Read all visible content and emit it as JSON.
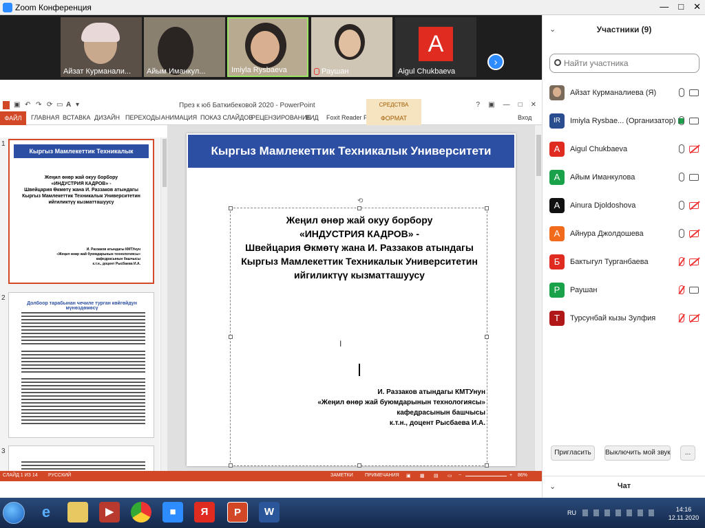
{
  "window": {
    "title": "Zoom Конференция",
    "buttons": [
      "—",
      "□",
      "✕"
    ]
  },
  "videos": [
    {
      "name": "Айзат Курманали...",
      "muted": false
    },
    {
      "name": "Айым Иманкул...",
      "muted": false
    },
    {
      "name": "Imiyla Rysbaeva",
      "muted": false
    },
    {
      "name": "Раушан",
      "muted": true
    },
    {
      "name": "Aigul Chukbaeva",
      "muted": false,
      "avatar": "A"
    }
  ],
  "powerpoint": {
    "title": "През к юб Баткибековой 2020 - PowerPoint",
    "context_tab_header": "СРЕДСТВА РИСОВАНИЯ",
    "tabs": [
      "ФАЙЛ",
      "ГЛАВНАЯ",
      "ВСТАВКА",
      "ДИЗАЙН",
      "ПЕРЕХОДЫ",
      "АНИМАЦИЯ",
      "ПОКАЗ СЛАЙДОВ",
      "РЕЦЕНЗИРОВАНИЕ",
      "ВИД",
      "Foxit Reader PDF",
      "ФОРМАТ"
    ],
    "login": "Вход",
    "thumb_numbers": [
      "1",
      "2",
      "3"
    ],
    "thumb1": {
      "banner": "Кыргыз Мамлекеттик Техникалык Университети",
      "center": [
        "Жеңил өнөр жай окуу борбору",
        "«ИНДУСТРИЯ КАДРОВ» -",
        "Швейцария Өкмөтү жана И. Раззаков атындагы",
        "Кыргыз Мамлекеттик Техникалык Университетин",
        "ийгиликтүү кызматташуусу"
      ],
      "right": [
        "И. Раззаков атындагы КМТУнун",
        "«Жеңил өнөр жай буюмдарынын технологиясы»",
        "кафедрасынын башчысы",
        "к.т.н., доцент Рысбаева И.А."
      ]
    },
    "thumb2_heading": "Долбоор тарабынан чечиле турган көйгөйдүн мүнөздөмөсү",
    "slide": {
      "banner": "Кыргыз Мамлекеттик Техникалык Университети",
      "main": [
        "Жеңил өнөр жай окуу борбору",
        "«ИНДУСТРИЯ КАДРОВ» -",
        "Швейцария Өкмөтү жана И. Раззаков атындагы",
        "Кыргыз Мамлекеттик Техникалык Университетин",
        "ийгиликтүү кызматташуусу"
      ],
      "signature": [
        "И. Раззаков атындагы КМТУнун",
        "«Жеңил өнөр жай буюмдарынын технологиясы»",
        "кафедрасынын башчысы",
        "к.т.н., доцент Рысбаева И.А."
      ]
    },
    "status": {
      "slide": "СЛАЙД 1 ИЗ 14",
      "lang": "РУССКИЙ",
      "notes": "ЗАМЕТКИ",
      "comments": "ПРИМЕЧАНИЯ",
      "zoom": "86%"
    }
  },
  "participants": {
    "header": "Участники (9)",
    "search_placeholder": "Найти участника",
    "list": [
      {
        "name": "Айзат Курманалиева (Я)",
        "initials": "",
        "color": "#7a6a5a",
        "mic_muted": false,
        "cam_off": false,
        "photo": true
      },
      {
        "name": "Imiyla Rysbae... (Организатор)",
        "initials": "IR",
        "color": "#2a4d8f",
        "mic_muted": false,
        "cam_off": false,
        "share": true
      },
      {
        "name": "Aigul Chukbaeva",
        "initials": "A",
        "color": "#e02b20",
        "mic_muted": false,
        "cam_off": true
      },
      {
        "name": "Айым Иманкулова",
        "initials": "A",
        "color": "#1aa24a",
        "mic_muted": false,
        "cam_off": false
      },
      {
        "name": "Ainura Djoldoshova",
        "initials": "A",
        "color": "#111111",
        "mic_muted": false,
        "cam_off": true
      },
      {
        "name": "Айнура Джолдошева",
        "initials": "A",
        "color": "#f26b1d",
        "mic_muted": false,
        "cam_off": true
      },
      {
        "name": "Бактыгул Турганбаева",
        "initials": "Б",
        "color": "#e02b20",
        "mic_muted": true,
        "cam_off": true
      },
      {
        "name": "Раушан",
        "initials": "Р",
        "color": "#1aa24a",
        "mic_muted": true,
        "cam_off": false
      },
      {
        "name": "Турсунбай кызы Зулфия",
        "initials": "Т",
        "color": "#b01818",
        "mic_muted": true,
        "cam_off": true
      }
    ],
    "invite": "Пригласить",
    "mute_me": "Выключить мой звук",
    "more": "..."
  },
  "chat": {
    "label": "Чат"
  },
  "taskbar": {
    "lang": "RU",
    "time": "14:16",
    "date": "12.11.2020"
  }
}
